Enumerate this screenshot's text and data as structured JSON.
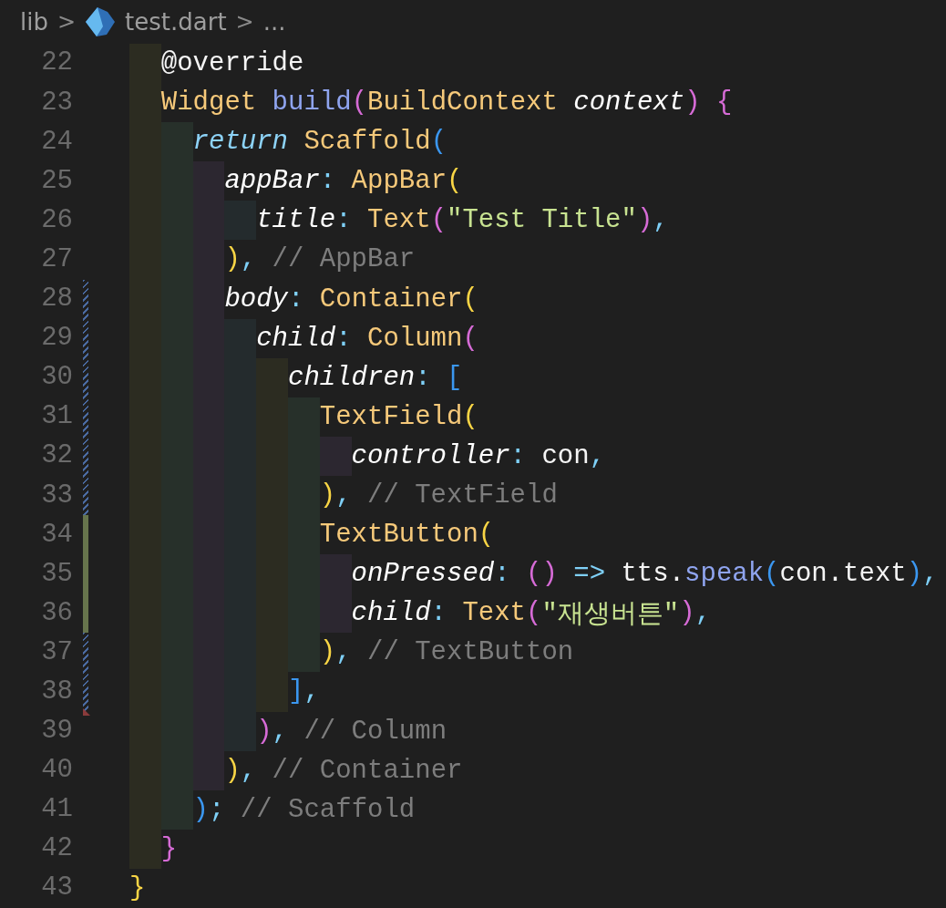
{
  "breadcrumb": [
    {
      "kind": "folder",
      "label": "lib"
    },
    {
      "kind": "separator",
      "label": ">"
    },
    {
      "kind": "file",
      "label": "test.dart"
    },
    {
      "kind": "separator",
      "label": ">"
    },
    {
      "kind": "more",
      "label": "..."
    }
  ],
  "lines": [
    {
      "number": "22",
      "modified": false,
      "added": false,
      "deleted_below": false,
      "tokens": [
        {
          "kind": "plain",
          "text": "  @override"
        }
      ]
    },
    {
      "number": "23",
      "modified": false,
      "added": false,
      "deleted_below": false,
      "tokens": [
        {
          "kind": "type",
          "text": "  Widget"
        },
        {
          "kind": "function",
          "text": " build"
        },
        {
          "kind": "bracket",
          "color": "#d66bd6",
          "text": "("
        },
        {
          "kind": "type",
          "text": "BuildContext"
        },
        {
          "kind": "param",
          "text": " context"
        },
        {
          "kind": "bracket",
          "color": "#d66bd6",
          "text": ")"
        },
        {
          "kind": "bracket",
          "color": "#d66bd6",
          "text": " {"
        }
      ]
    },
    {
      "number": "24",
      "modified": false,
      "added": false,
      "deleted_below": false,
      "tokens": [
        {
          "kind": "keyword",
          "text": "    return"
        },
        {
          "kind": "type",
          "text": " Scaffold"
        },
        {
          "kind": "bracket",
          "color": "#3b97f0",
          "text": "("
        }
      ]
    },
    {
      "number": "25",
      "modified": false,
      "added": false,
      "deleted_below": false,
      "tokens": [
        {
          "kind": "param",
          "text": "      appBar"
        },
        {
          "kind": "punct",
          "text": ":"
        },
        {
          "kind": "type",
          "text": " AppBar"
        },
        {
          "kind": "bracket",
          "color": "#f9d545",
          "text": "("
        }
      ]
    },
    {
      "number": "26",
      "modified": false,
      "added": false,
      "deleted_below": false,
      "tokens": [
        {
          "kind": "param",
          "text": "        title"
        },
        {
          "kind": "punct",
          "text": ":"
        },
        {
          "kind": "type",
          "text": " Text"
        },
        {
          "kind": "bracket",
          "color": "#d66bd6",
          "text": "("
        },
        {
          "kind": "string",
          "text": "\"Test Title\""
        },
        {
          "kind": "bracket",
          "color": "#d66bd6",
          "text": ")"
        },
        {
          "kind": "punct",
          "text": ","
        }
      ]
    },
    {
      "number": "27",
      "modified": false,
      "added": false,
      "deleted_below": false,
      "tokens": [
        {
          "kind": "bracket",
          "color": "#f9d545",
          "text": "      )"
        },
        {
          "kind": "punct",
          "text": ","
        },
        {
          "kind": "comment",
          "text": " // AppBar"
        }
      ]
    },
    {
      "number": "28",
      "modified": true,
      "added": false,
      "deleted_below": false,
      "tokens": [
        {
          "kind": "param",
          "text": "      body"
        },
        {
          "kind": "punct",
          "text": ":"
        },
        {
          "kind": "type",
          "text": " Container"
        },
        {
          "kind": "bracket",
          "color": "#f9d545",
          "text": "("
        }
      ]
    },
    {
      "number": "29",
      "modified": true,
      "added": false,
      "deleted_below": false,
      "tokens": [
        {
          "kind": "param",
          "text": "        child"
        },
        {
          "kind": "punct",
          "text": ":"
        },
        {
          "kind": "type",
          "text": " Column"
        },
        {
          "kind": "bracket",
          "color": "#d66bd6",
          "text": "("
        }
      ]
    },
    {
      "number": "30",
      "modified": true,
      "added": false,
      "deleted_below": false,
      "tokens": [
        {
          "kind": "param",
          "text": "          children"
        },
        {
          "kind": "punct",
          "text": ":"
        },
        {
          "kind": "bracket",
          "color": "#3b97f0",
          "text": " ["
        }
      ]
    },
    {
      "number": "31",
      "modified": true,
      "added": false,
      "deleted_below": false,
      "tokens": [
        {
          "kind": "type",
          "text": "            TextField"
        },
        {
          "kind": "bracket",
          "color": "#f9d545",
          "text": "("
        }
      ]
    },
    {
      "number": "32",
      "modified": true,
      "added": false,
      "deleted_below": false,
      "tokens": [
        {
          "kind": "param",
          "text": "              controller"
        },
        {
          "kind": "punct",
          "text": ":"
        },
        {
          "kind": "plain",
          "text": " con"
        },
        {
          "kind": "punct",
          "text": ","
        }
      ]
    },
    {
      "number": "33",
      "modified": true,
      "added": false,
      "deleted_below": false,
      "tokens": [
        {
          "kind": "bracket",
          "color": "#f9d545",
          "text": "            )"
        },
        {
          "kind": "punct",
          "text": ","
        },
        {
          "kind": "comment",
          "text": " // TextField"
        }
      ]
    },
    {
      "number": "34",
      "modified": false,
      "added": true,
      "deleted_below": false,
      "tokens": [
        {
          "kind": "type",
          "text": "            TextButton"
        },
        {
          "kind": "bracket",
          "color": "#f9d545",
          "text": "("
        }
      ]
    },
    {
      "number": "35",
      "modified": false,
      "added": true,
      "deleted_below": false,
      "tokens": [
        {
          "kind": "param",
          "text": "              onPressed"
        },
        {
          "kind": "punct",
          "text": ":"
        },
        {
          "kind": "bracket",
          "color": "#d66bd6",
          "text": " ()"
        },
        {
          "kind": "punct",
          "text": " =>"
        },
        {
          "kind": "plain",
          "text": " tts."
        },
        {
          "kind": "function",
          "text": "speak"
        },
        {
          "kind": "bracket",
          "color": "#3b97f0",
          "text": "("
        },
        {
          "kind": "plain",
          "text": "con.text"
        },
        {
          "kind": "bracket",
          "color": "#3b97f0",
          "text": ")"
        },
        {
          "kind": "punct",
          "text": ","
        }
      ]
    },
    {
      "number": "36",
      "modified": false,
      "added": true,
      "deleted_below": false,
      "tokens": [
        {
          "kind": "param",
          "text": "              child"
        },
        {
          "kind": "punct",
          "text": ":"
        },
        {
          "kind": "type",
          "text": " Text"
        },
        {
          "kind": "bracket",
          "color": "#d66bd6",
          "text": "("
        },
        {
          "kind": "string",
          "text": "\"재생버튼\""
        },
        {
          "kind": "bracket",
          "color": "#d66bd6",
          "text": ")"
        },
        {
          "kind": "punct",
          "text": ","
        }
      ]
    },
    {
      "number": "37",
      "modified": true,
      "added": false,
      "deleted_below": false,
      "tokens": [
        {
          "kind": "bracket",
          "color": "#f9d545",
          "text": "            )"
        },
        {
          "kind": "punct",
          "text": ","
        },
        {
          "kind": "comment",
          "text": " // TextButton"
        }
      ]
    },
    {
      "number": "38",
      "modified": true,
      "added": false,
      "deleted_below": true,
      "tokens": [
        {
          "kind": "bracket",
          "color": "#3b97f0",
          "text": "          ]"
        },
        {
          "kind": "punct",
          "text": ","
        }
      ]
    },
    {
      "number": "39",
      "modified": false,
      "added": false,
      "deleted_below": false,
      "tokens": [
        {
          "kind": "bracket",
          "color": "#d66bd6",
          "text": "        )"
        },
        {
          "kind": "punct",
          "text": ","
        },
        {
          "kind": "comment",
          "text": " // Column"
        }
      ]
    },
    {
      "number": "40",
      "modified": false,
      "added": false,
      "deleted_below": false,
      "tokens": [
        {
          "kind": "bracket",
          "color": "#f9d545",
          "text": "      )"
        },
        {
          "kind": "punct",
          "text": ","
        },
        {
          "kind": "comment",
          "text": " // Container"
        }
      ]
    },
    {
      "number": "41",
      "modified": false,
      "added": false,
      "deleted_below": false,
      "tokens": [
        {
          "kind": "bracket",
          "color": "#3b97f0",
          "text": "    )"
        },
        {
          "kind": "punct",
          "text": ";"
        },
        {
          "kind": "comment",
          "text": " // Scaffold"
        }
      ]
    },
    {
      "number": "42",
      "modified": false,
      "added": false,
      "deleted_below": false,
      "tokens": [
        {
          "kind": "bracket",
          "color": "#d66bd6",
          "text": "  }"
        }
      ]
    },
    {
      "number": "43",
      "modified": false,
      "added": false,
      "deleted_below": false,
      "tokens": [
        {
          "kind": "bracket",
          "color": "#f9d545",
          "text": "}"
        }
      ]
    }
  ]
}
